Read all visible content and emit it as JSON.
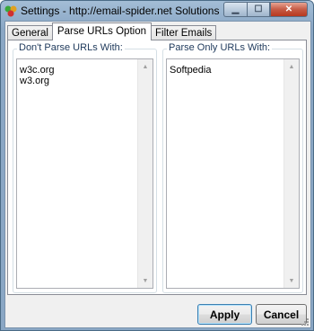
{
  "window": {
    "title": "Settings - http://email-spider.net Solutions"
  },
  "tabs": [
    {
      "label": "General",
      "active": false
    },
    {
      "label": "Parse URLs Option",
      "active": true
    },
    {
      "label": "Filter Emails",
      "active": false
    }
  ],
  "left_group": {
    "label": "Don't Parse URLs With:",
    "items": [
      "w3c.org",
      "w3.org"
    ]
  },
  "right_group": {
    "label": "Parse Only URLs With:",
    "items": [
      "Softpedia"
    ]
  },
  "buttons": {
    "apply": "Apply",
    "cancel": "Cancel"
  },
  "icons": {
    "app": "colored-balls-icon",
    "minimize": "minimize-icon",
    "maximize": "maximize-icon",
    "close": "close-icon"
  },
  "colors": {
    "titlebar": "#8ba8c6",
    "close_button": "#c65b45",
    "group_label": "#1e395b"
  }
}
